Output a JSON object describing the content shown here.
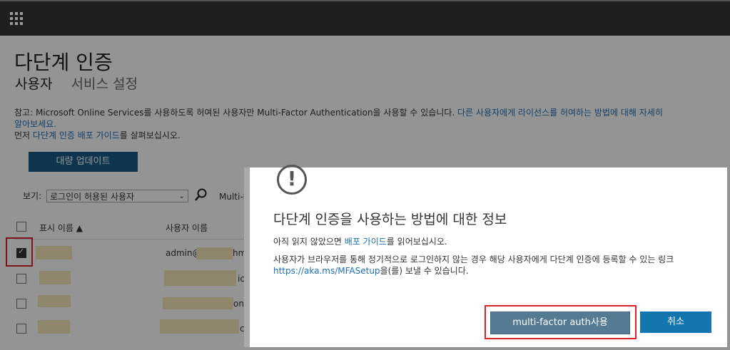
{
  "page": {
    "title": "다단계 인증",
    "tabs": [
      "사용자",
      "서비스 설정"
    ],
    "note_prefix": "참고: Microsoft Online Services를 사용하도록 허여된 사용자만 Multi-Factor Authentication을 사용할 수 있습니다.",
    "note_link1": "다른 사용자에게 라이선스를 허여하는 방법에 대해 자세히 알아보세요.",
    "note_line2_a": "먼저",
    "note_link2": "다단계 인증 배포 가이드",
    "note_line2_b": "를 살펴보십시오.",
    "bulk_update": "대량 업데이트",
    "view_label": "보기:",
    "view_value": "로그인이 허용된 사용자",
    "mfa_filter_label": "Multi-F",
    "col_display_name": "표시 이름 ▲",
    "col_user_name": "사용자 이름",
    "row1_user_prefix": "admin@",
    "row1_user_suffix": "hm",
    "trailing_text": "ic",
    "trailing_text2": "onl",
    "trailing_text3": "c"
  },
  "dialog": {
    "title": "다단계 인증을 사용하는 방법에 대한 정보",
    "p1_a": "아직 읽지 않았으면",
    "p1_link": "배포 가이드",
    "p1_b": "를 읽어보십시오.",
    "p2_a": "사용자가 브라우저를 통해 정기적으로 로그인하지 않는 경우 해당 사용자에게 다단계 인증에 등록할 수 있는 링크",
    "p2_link": "https://aka.ms/MFASetup",
    "p2_b": "을(를) 보낼 수 있습니다.",
    "enable_button": "multi-factor auth사용",
    "cancel_button": "취소"
  },
  "colors": {
    "accent": "#1376ae",
    "highlight": "#d9232c",
    "redaction": "#f4e7b9"
  },
  "icons": [
    "waffle-icon",
    "search-icon",
    "warning-icon",
    "sort-ascending-icon"
  ]
}
